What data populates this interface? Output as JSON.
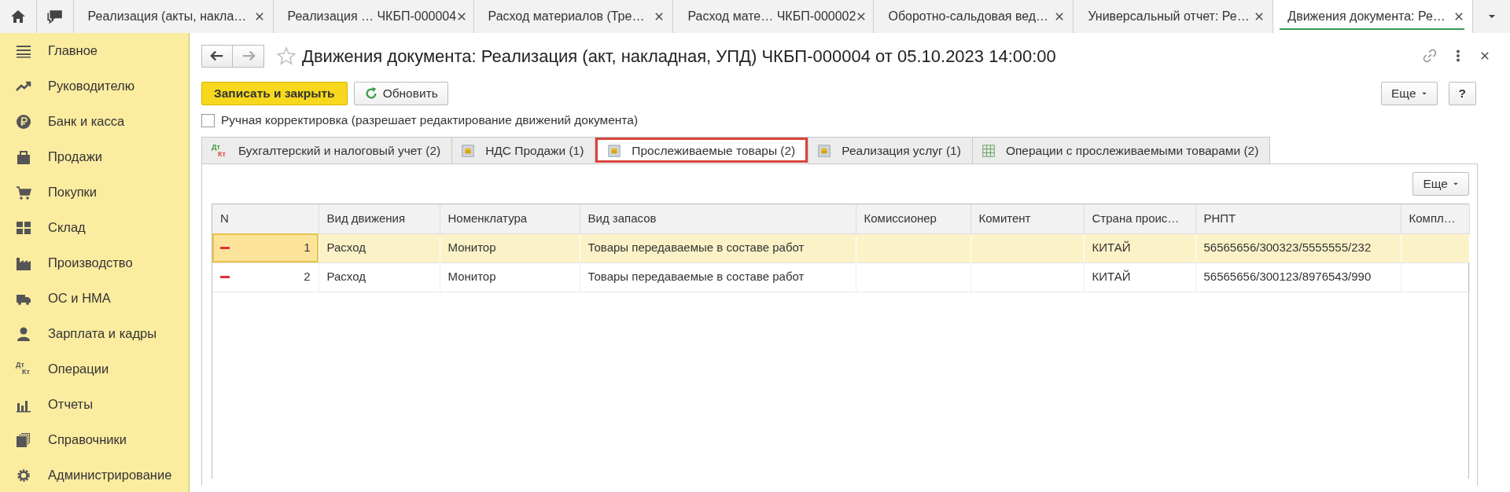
{
  "window_tabs": [
    {
      "title": "Реализация (акты, накла…",
      "selected": false
    },
    {
      "title": "Реализация … ЧКБП-000004",
      "selected": false
    },
    {
      "title": "Расход материалов (Тре…",
      "selected": false
    },
    {
      "title": "Расход мате… ЧКБП-000002",
      "selected": false
    },
    {
      "title": "Оборотно-сальдовая вед…",
      "selected": false
    },
    {
      "title": "Универсальный отчет: Ре…",
      "selected": false
    },
    {
      "title": "Движения документа: Ре…",
      "selected": true
    }
  ],
  "sidebar": {
    "items": [
      {
        "label": "Главное"
      },
      {
        "label": "Руководителю"
      },
      {
        "label": "Банк и касса"
      },
      {
        "label": "Продажи"
      },
      {
        "label": "Покупки"
      },
      {
        "label": "Склад"
      },
      {
        "label": "Производство"
      },
      {
        "label": "ОС и НМА"
      },
      {
        "label": "Зарплата и кадры"
      },
      {
        "label": "Операции",
        "icon_text": [
          "Дт",
          "Кт"
        ]
      },
      {
        "label": "Отчеты"
      },
      {
        "label": "Справочники"
      },
      {
        "label": "Администрирование"
      }
    ]
  },
  "form": {
    "title": "Движения документа: Реализация (акт, накладная, УПД) ЧКБП-000004 от 05.10.2023 14:00:00",
    "buttons": {
      "save_close": "Записать и закрыть",
      "refresh": "Обновить",
      "more": "Еще",
      "help": "?"
    },
    "manual_edit": {
      "label": "Ручная корректировка (разрешает редактирование движений документа)",
      "checked": false
    },
    "tabs": [
      {
        "label": "Бухгалтерский и налоговый учет (2)",
        "icon_text": [
          "Дт",
          "Кт"
        ],
        "selected": false
      },
      {
        "label": "НДС Продажи (1)",
        "selected": false
      },
      {
        "label": "Прослеживаемые товары (2)",
        "selected": true
      },
      {
        "label": "Реализация услуг (1)",
        "selected": false
      },
      {
        "label": "Операции с прослеживаемыми товарами (2)",
        "selected": false
      }
    ],
    "table_more": "Еще",
    "table": {
      "columns": [
        "N",
        "Вид движения",
        "Номенклатура",
        "Вид запасов",
        "Комиссионер",
        "Комитент",
        "Страна проис…",
        "РНПТ",
        "Компл…"
      ],
      "rows": [
        {
          "selected": true,
          "cells": [
            "1",
            "Расход",
            "Монитор",
            "Товары передаваемые в составе работ",
            "",
            "",
            "КИТАЙ",
            "56565656/300323/5555555/232",
            ""
          ]
        },
        {
          "selected": false,
          "cells": [
            "2",
            "Расход",
            "Монитор",
            "Товары передаваемые в составе работ",
            "",
            "",
            "КИТАЙ",
            "56565656/300123/8976543/990",
            ""
          ]
        }
      ]
    }
  }
}
